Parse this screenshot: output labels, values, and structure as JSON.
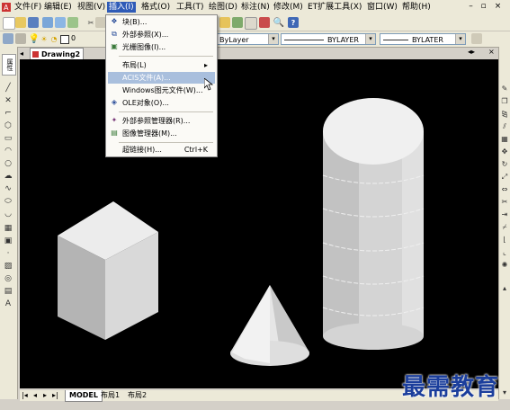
{
  "menubar": {
    "items": [
      "文件(F)",
      "编辑(E)",
      "视图(V)",
      "插入(I)",
      "格式(O)",
      "工具(T)",
      "绘图(D)",
      "标注(N)",
      "修改(M)",
      "ET扩展工具(X)",
      "窗口(W)",
      "帮助(H)"
    ],
    "window_controls": [
      "–",
      "▫",
      "×"
    ]
  },
  "toolbar": {
    "layer_value": "0",
    "linetype_1": "ByLayer",
    "linetype_2": "BYLAYER",
    "lineweight": "BYLATER"
  },
  "insert_menu": {
    "items": [
      {
        "label": "块(B)...",
        "icon": "block-icon",
        "shortcut": ""
      },
      {
        "label": "外部参照(X)...",
        "icon": "xref-icon",
        "shortcut": ""
      },
      {
        "label": "光栅图像(I)...",
        "icon": "raster-image-icon",
        "shortcut": ""
      },
      {
        "label": "布局(L)",
        "icon": "",
        "shortcut": "",
        "submenu": "▸"
      },
      {
        "label": "ACIS文件(A)...",
        "icon": "",
        "shortcut": "",
        "highlighted": true
      },
      {
        "label": "Windows图元文件(W)...",
        "icon": "",
        "shortcut": ""
      },
      {
        "label": "OLE对象(O)...",
        "icon": "ole-object-icon",
        "shortcut": ""
      },
      {
        "label": "外部参照管理器(R)...",
        "icon": "xref-manager-icon",
        "shortcut": ""
      },
      {
        "label": "图像管理器(M)...",
        "icon": "image-manager-icon",
        "shortcut": ""
      },
      {
        "label": "超链接(H)...",
        "icon": "",
        "shortcut": "Ctrl+K"
      }
    ]
  },
  "document": {
    "tab_title": "Drawing2"
  },
  "layout_tabs": {
    "nav": [
      "|◂",
      "◂",
      "▸",
      "▸|"
    ],
    "tabs": [
      "MODEL",
      "布局1",
      "布局2"
    ]
  },
  "left_panel_label": "属性",
  "watermark": "最需教育",
  "colors": {
    "viewport_bg": "#000000",
    "menu_highlight": "#2f5bb7",
    "menu_item_highlight": "#a9bfdd",
    "watermark": "#1b3e9c",
    "chrome_bg": "#ece9d8"
  }
}
